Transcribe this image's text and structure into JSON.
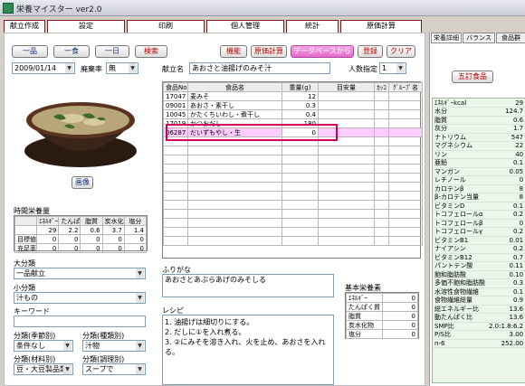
{
  "app": {
    "title": "栄養マイスター ver2.0",
    "colors": {
      "accent": "#8a1a1a",
      "highlight": "#ff99ff",
      "selected": "#d0005a"
    }
  },
  "tabs": [
    "献立作成",
    "設定",
    "印刷",
    "個人管理",
    "統計",
    "原価計算"
  ],
  "toolbar": {
    "ichihin": "一品",
    "ichishoku": "一食",
    "ichinichi": "一日",
    "search": "検索",
    "kino": "機能",
    "genka": "原価計算",
    "delete_db": "データベースから削除",
    "register": "登録",
    "clear": "クリア"
  },
  "left": {
    "date": "2009/01/14",
    "haiki_label": "廃棄率",
    "haiki_value": "無",
    "image_button": "画像",
    "jikan_title": "時間栄養量",
    "jikan_headers": [
      "",
      "ｴﾈﾙｷﾞｰ",
      "たんぱく質",
      "脂質",
      "炭水化物",
      "塩分"
    ],
    "jikan_rows": [
      [
        "",
        "29",
        "2.2",
        "0.6",
        "3.7",
        "1.4"
      ],
      [
        "目標値",
        "0",
        "0",
        "0",
        "0",
        "0"
      ],
      [
        "充足率",
        "0",
        "0",
        "0",
        "0",
        "0"
      ]
    ],
    "daibunrui_label": "大分類",
    "daibunrui_value": "一品献立",
    "shobunrui_label": "小分類",
    "shobunrui_value": "汁もの",
    "keyword_label": "キーワード",
    "keyword_value": "",
    "bunrui_kisetsu_label": "分類(季節別)",
    "bunrui_kisetsu_value": "条件なし",
    "bunrui_shurui_label": "分類(種類別)",
    "bunrui_shurui_value": "汁物",
    "bunrui_zairyo_label": "分類(材料別)",
    "bunrui_zairyo_value": "豆・大豆製品類",
    "bunrui_chori_label": "分類(調理別)",
    "bunrui_chori_value": "スープで"
  },
  "main": {
    "kondate_label": "献立名",
    "kondate_value": "あおさと油揚げのみそ汁",
    "ninzu_label": "人数指定",
    "ninzu_value": "1",
    "headers": [
      "食品No",
      "食品名",
      "重量(g)",
      "目安量",
      "ｶｯｺ",
      "ｸﾞﾙｰﾌﾟ名"
    ],
    "rows": [
      [
        "17047",
        "麦みそ",
        "12",
        "",
        "",
        ""
      ],
      [
        "09001",
        "あおさ・素干し",
        "0.3",
        "",
        "",
        ""
      ],
      [
        "10045",
        "かたくちいわし・煮干し",
        "0.4",
        "",
        "",
        ""
      ],
      [
        "17019",
        "かつおだし",
        "180",
        "",
        "",
        ""
      ],
      [
        "06287",
        "だいずもやし・生",
        "0",
        "",
        "",
        ""
      ]
    ],
    "furigana_label": "ふりがな",
    "furigana_value": "あおさとあぶらあげのみそしる",
    "recipe_label": "レシピ",
    "recipe_lines": [
      "1. 油揚げは細切りにする。",
      "2. だしに①を入れ煮る。",
      "3. ②にみそを溶き入れ、火を止め、あおさを入れる。"
    ],
    "kihon_title": "基本栄養素",
    "kihon_rows": [
      [
        "ｴﾈﾙｷﾞｰ",
        "0"
      ],
      [
        "たんぱく質",
        "0"
      ],
      [
        "脂質",
        "0"
      ],
      [
        "炭水化物",
        "0"
      ],
      [
        "塩分",
        "0"
      ]
    ]
  },
  "right": {
    "tabs": [
      "栄養詳細",
      "バランス",
      "食品群"
    ],
    "group_button": "五訂食品",
    "nutrients": [
      [
        "ｴﾈﾙｷﾞｰkcal",
        "29"
      ],
      [
        "水分",
        "124.7"
      ],
      [
        "脂質",
        "0.6"
      ],
      [
        "灰分",
        "1.7"
      ],
      [
        "ナトリウム",
        "547"
      ],
      [
        "マグネシウム",
        "22"
      ],
      [
        "リン",
        "40"
      ],
      [
        "亜鉛",
        "0.1"
      ],
      [
        "マンガン",
        "0.05"
      ],
      [
        "レチノール",
        "0"
      ],
      [
        "カロテンβ",
        "8"
      ],
      [
        "β-カロテン当量",
        "8"
      ],
      [
        "ビタミンD",
        "0.1"
      ],
      [
        "トコフェロールα",
        "0.2"
      ],
      [
        "トコフェロールβ",
        "0"
      ],
      [
        "トコフェロールγ",
        "0.2"
      ],
      [
        "ビタミンB1",
        "0.01"
      ],
      [
        "ナイアシン",
        "0.2"
      ],
      [
        "ビタミンB12",
        "0.7"
      ],
      [
        "パントテン酸",
        "0.11"
      ],
      [
        "飽和脂肪酸",
        "0.10"
      ],
      [
        "多価不飽和脂肪酸",
        "0.3"
      ],
      [
        "水溶性食物繊維",
        "0.1"
      ],
      [
        "食物繊維総量",
        "0.9"
      ],
      [
        "総エネルギー比",
        "13.6"
      ],
      [
        "動たんぱく比",
        "13.6"
      ],
      [
        "SMP比",
        "2.0:1.8:6.2"
      ],
      [
        "P/S比",
        "3.00"
      ],
      [
        "n-6",
        "252.00"
      ]
    ]
  }
}
